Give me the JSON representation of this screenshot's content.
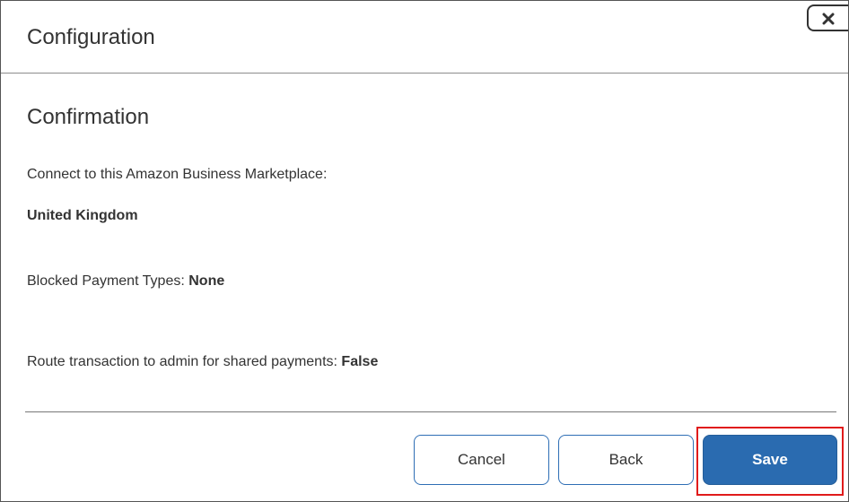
{
  "dialog": {
    "title": "Configuration",
    "close_icon": "close-icon"
  },
  "confirmation": {
    "heading": "Confirmation",
    "marketplace_label": "Connect to this Amazon Business Marketplace:",
    "marketplace_value": "United Kingdom",
    "blocked_label": "Blocked Payment Types:",
    "blocked_value": "None",
    "route_label": "Route transaction to admin for shared payments:",
    "route_value": "False"
  },
  "footer": {
    "cancel_label": "Cancel",
    "back_label": "Back",
    "save_label": "Save"
  },
  "colors": {
    "primary": "#2a6bb0",
    "highlight": "#e01b1b"
  }
}
